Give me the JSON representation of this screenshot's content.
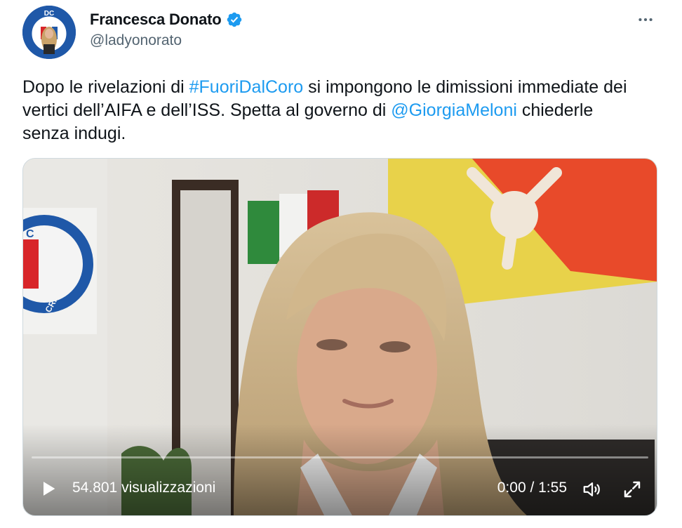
{
  "author": {
    "display_name": "Francesca Donato",
    "handle": "@ladyonorato",
    "avatar_badge_text": "DC",
    "verified": true
  },
  "tweet": {
    "text_1": "Dopo le rivelazioni di ",
    "hashtag": "#FuoriDalCoro",
    "text_2": " si impongono le dimissioni immediate dei vertici dell’AIFA e dell’ISS. Spetta al governo di ",
    "mention": "@GiorgiaMeloni",
    "text_3": " chiederle senza indugi."
  },
  "video": {
    "views_label": "54.801 visualizzazioni",
    "time_label": "0:00 / 1:55",
    "progress": 0,
    "logo_text_top": "C",
    "logo_text_side": "CRISTIANA"
  },
  "icons": {
    "more": "more-horizontal-icon",
    "verified": "verified-badge-icon",
    "play": "play-icon",
    "volume": "volume-icon",
    "fullscreen": "fullscreen-icon"
  },
  "colors": {
    "link": "#1d9bf0",
    "secondary_text": "#536471",
    "verified": "#1d9bf0"
  }
}
